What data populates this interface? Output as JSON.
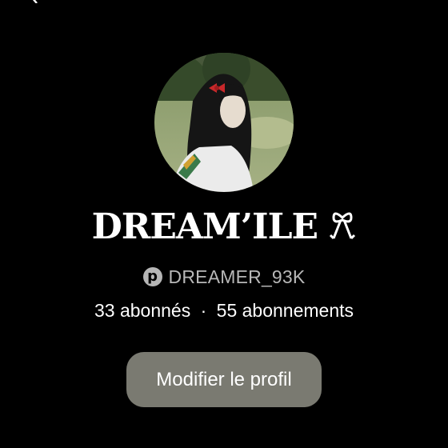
{
  "header": {
    "back_icon": "chevron-left-icon",
    "share_icon": "share-icon"
  },
  "profile": {
    "avatar_icon": "profile-photo",
    "display_name": "DREAM’ILE",
    "display_name_decoration": "🎀",
    "platform_icon": "pinterest-icon",
    "username": "DREAMER_93K",
    "followers": "33 abonnés",
    "separator": "·",
    "following": "55 abonnements"
  },
  "actions": {
    "edit_profile_label": "Modifier le profil"
  },
  "colors": {
    "background": "#000000",
    "button": "#7a7a71",
    "muted_text": "#b8b8b8"
  }
}
